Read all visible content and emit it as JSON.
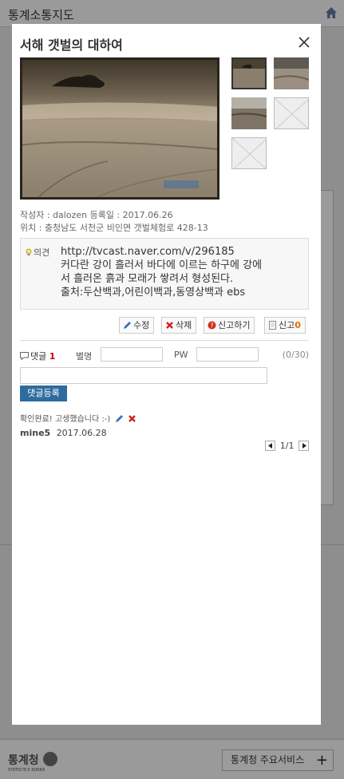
{
  "app": {
    "title": "통계소통지도",
    "footer_logo": "통계청",
    "footer_logo_sub": "STATISTICS KOREA",
    "footer_service": "통계청 주요서비스"
  },
  "modal": {
    "title": "서해 갯벌의 대하여",
    "author_line": "작성자 : dalozen       등록일 : 2017.06.26",
    "location_line": "위치 : 충청남도 서천군 비인면 갯벌체험로 428-13",
    "opinion": {
      "label": "의견",
      "lines": [
        "http://tvcast.naver.com/v/296185",
        "커다란 강이 흘러서 바다에 이르는 하구에 강에",
        "서 흘러온 흙과 모래가 쌓려서 형성된다.",
        "출처:두산백과,어린이백과,동영상백과 ebs"
      ]
    },
    "buttons": {
      "edit": "수정",
      "delete": "삭제",
      "report": "신고하기",
      "report_count_label": "신고",
      "report_count": "0"
    },
    "comment": {
      "header_label": "댓글",
      "count": "1",
      "nickname_label": "별명",
      "pw_label": "PW",
      "counter": "(0/30)",
      "submit": "댓글등록",
      "items": [
        {
          "text": "확인완료! 고생했습니다 :-)",
          "user": "mine5",
          "date": "2017.06.28"
        }
      ],
      "pager": "1/1"
    }
  },
  "colors": {
    "accent": "#2f6b9e",
    "count_red": "#cc0000",
    "report_orange": "#e07000"
  }
}
